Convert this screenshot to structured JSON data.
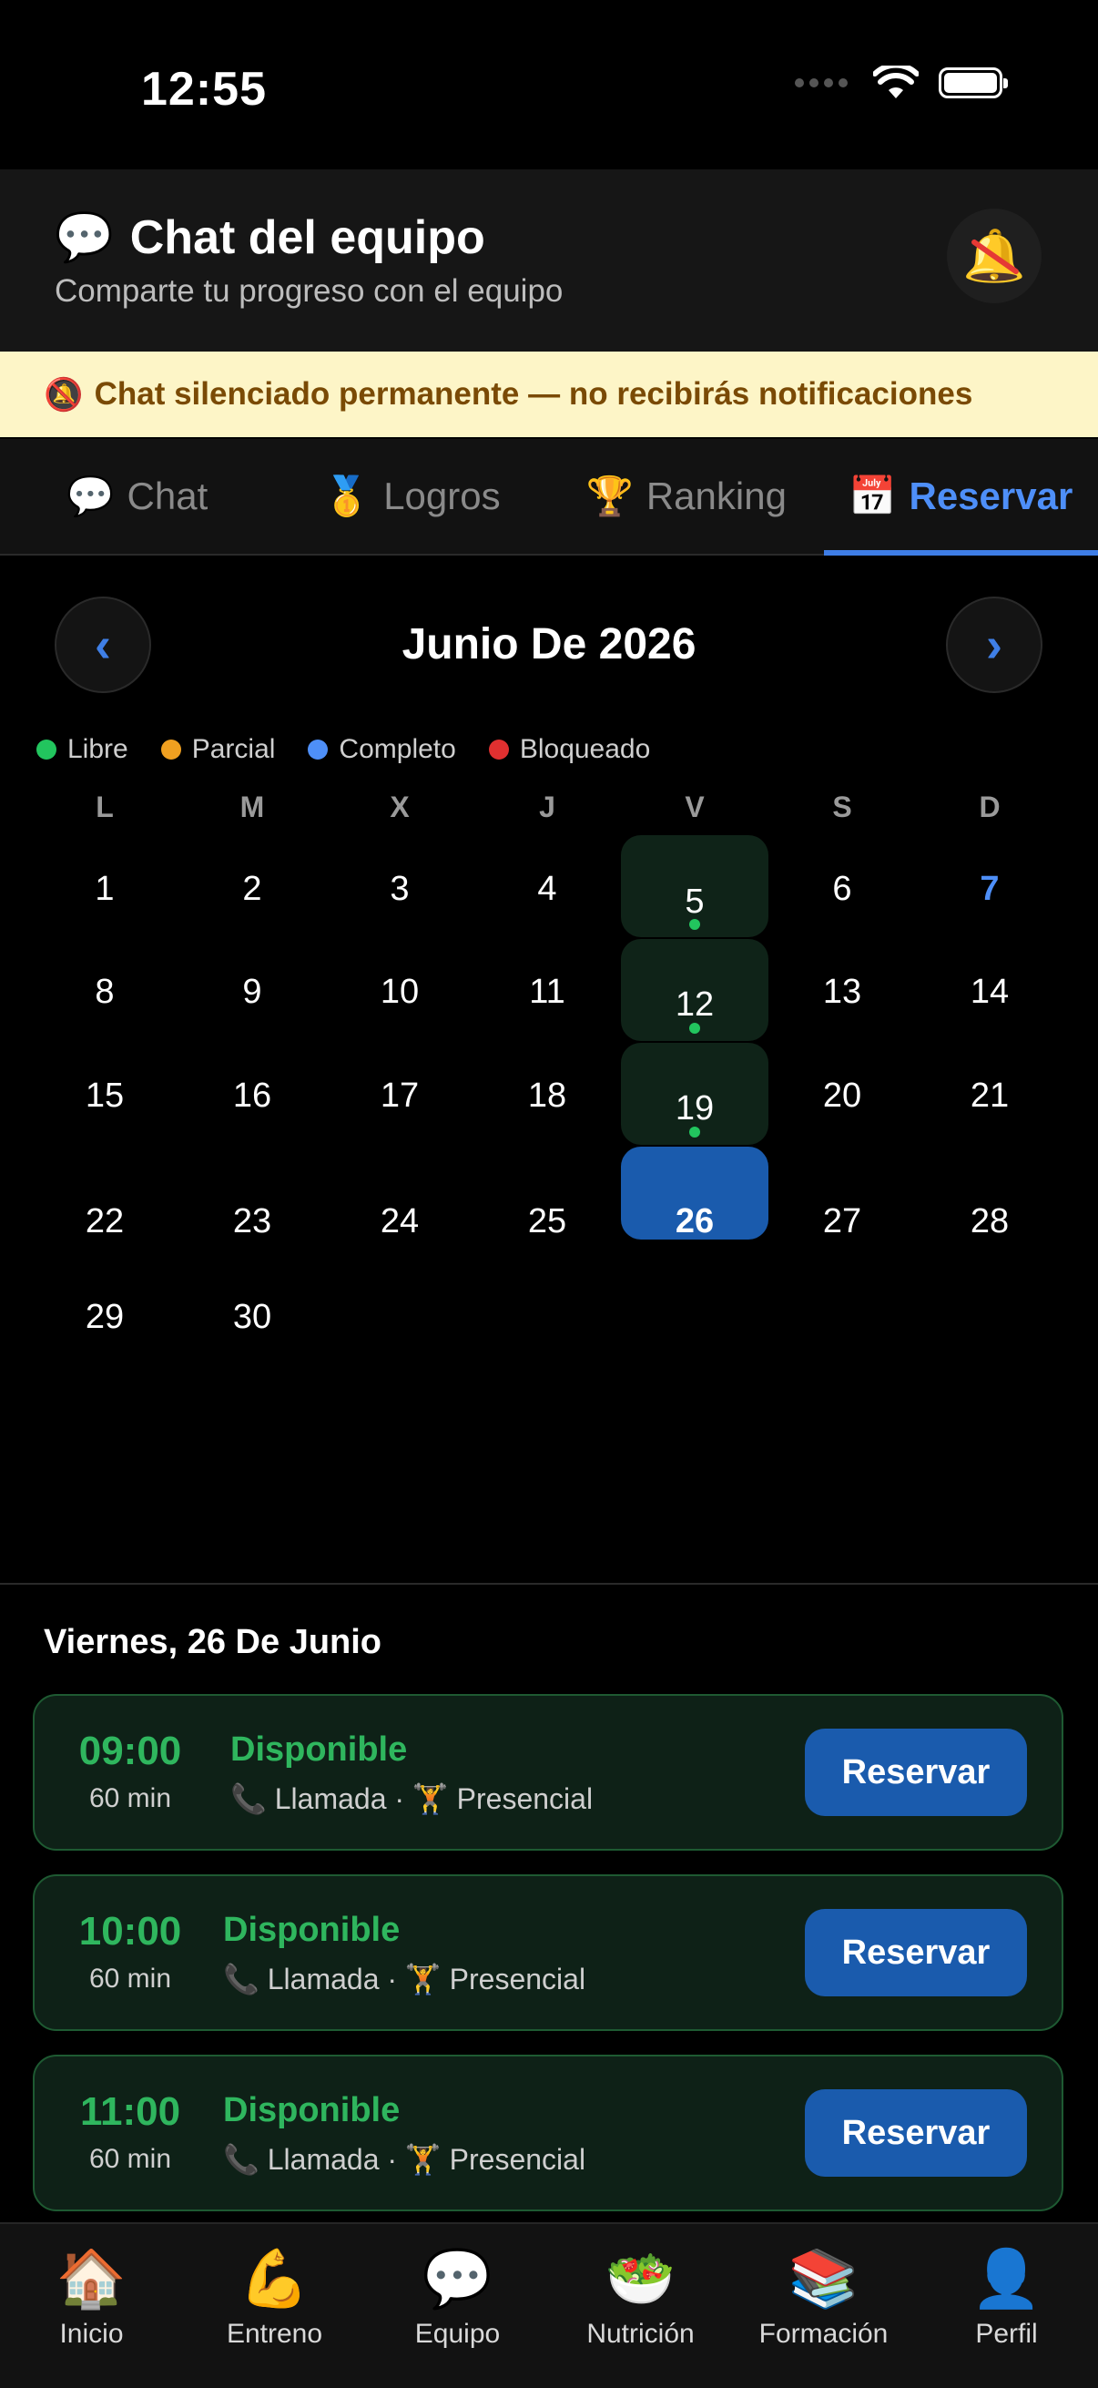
{
  "status_bar": {
    "time": "12:55"
  },
  "header": {
    "title": "Chat del equipo",
    "subtitle": "Comparte tu progreso con el equipo",
    "title_icon": "speech-bubble-icon",
    "bell_icon": "muted-bell-icon"
  },
  "banner": {
    "text": "Chat silenciado permanente — no recibirás notificaciones"
  },
  "tabs": [
    {
      "icon": "💬",
      "label": "Chat",
      "active": false
    },
    {
      "icon": "🥇",
      "label": "Logros",
      "active": false
    },
    {
      "icon": "🏆",
      "label": "Ranking",
      "active": false
    },
    {
      "icon": "📅",
      "label": "Reservar",
      "active": true
    }
  ],
  "calendar": {
    "month_title": "Junio De 2026",
    "prev": "‹",
    "next": "›",
    "legend": [
      {
        "label": "Libre",
        "color": "#22c55e"
      },
      {
        "label": "Parcial",
        "color": "#f0a020"
      },
      {
        "label": "Completo",
        "color": "#4e8ff8"
      },
      {
        "label": "Bloqueado",
        "color": "#e03030"
      }
    ],
    "weekdays": [
      "L",
      "M",
      "X",
      "J",
      "V",
      "S",
      "D"
    ],
    "today": "7",
    "selected": "26",
    "available_days": [
      "5",
      "12",
      "19"
    ],
    "days": [
      "1",
      "2",
      "3",
      "4",
      "5",
      "6",
      "7",
      "8",
      "9",
      "10",
      "11",
      "12",
      "13",
      "14",
      "15",
      "16",
      "17",
      "18",
      "19",
      "20",
      "21",
      "22",
      "23",
      "24",
      "25",
      "26",
      "27",
      "28",
      "29",
      "30"
    ]
  },
  "selected_date_label": "Viernes, 26 De Junio",
  "slots": [
    {
      "time": "09:00",
      "duration": "60 min",
      "status": "Disponible",
      "mode_call": "Llamada",
      "mode_sep": "·",
      "mode_in_person": "Presencial",
      "button": "Reservar"
    },
    {
      "time": "10:00",
      "duration": "60 min",
      "status": "Disponible",
      "mode_call": "Llamada",
      "mode_sep": "·",
      "mode_in_person": "Presencial",
      "button": "Reservar"
    },
    {
      "time": "11:00",
      "duration": "60 min",
      "status": "Disponible",
      "mode_call": "Llamada",
      "mode_sep": "·",
      "mode_in_person": "Presencial",
      "button": "Reservar"
    }
  ],
  "bottom_nav": [
    {
      "icon": "🏠",
      "label": "Inicio"
    },
    {
      "icon": "💪",
      "label": "Entreno"
    },
    {
      "icon": "💬",
      "label": "Equipo"
    },
    {
      "icon": "🥗",
      "label": "Nutrición"
    },
    {
      "icon": "📚",
      "label": "Formación"
    },
    {
      "icon": "👤",
      "label": "Perfil"
    }
  ]
}
